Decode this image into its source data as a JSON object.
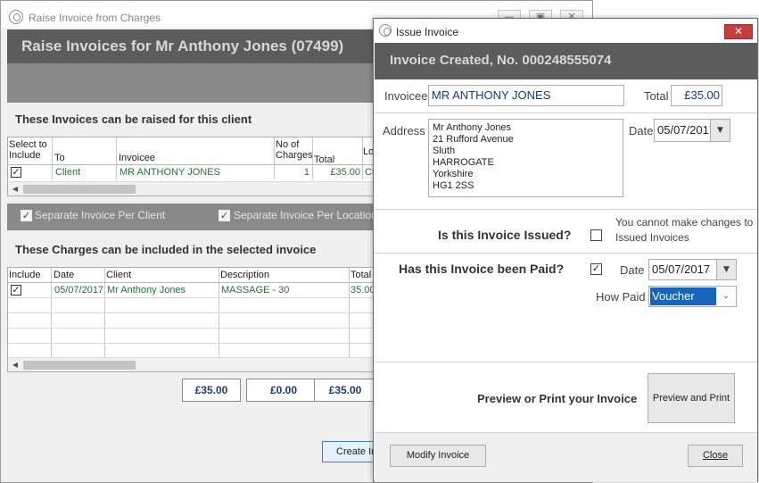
{
  "back_window": {
    "title": "Raise Invoice from Charges",
    "header": "Raise Invoices for Mr Anthony Jones (07499)",
    "invoices_section_label": "These Invoices can be raised for this client",
    "invoice_columns": [
      "Select to Include",
      "To",
      "Invoicee",
      "No of Charges",
      "Total",
      "Lo"
    ],
    "invoice_rows": [
      {
        "selected": "✓",
        "to": "Client",
        "invoicee": "MR ANTHONY JONES",
        "charges": "1",
        "total": "£35.00",
        "lo": "Cl"
      }
    ],
    "option_separate_client": "Separate Invoice Per Client",
    "option_separate_location": "Separate Invoice Per Location",
    "charges_section_label": "These Charges can be included in the selected invoice",
    "charge_columns": [
      "Include",
      "Date",
      "Client",
      "Description",
      "Total"
    ],
    "charge_rows": [
      {
        "include": "✓",
        "date": "05/07/2017",
        "client": "Mr Anthony Jones",
        "description": "MASSAGE - 30",
        "total": "35.00"
      }
    ],
    "totals": [
      "£35.00",
      "£0.00",
      "£35.00"
    ],
    "create_button": "Create Invoice"
  },
  "dialog": {
    "title": "Issue Invoice",
    "close_glyph": "✕",
    "header": "Invoice Created, No. 000248555074",
    "invoicee_label": "Invoicee",
    "invoicee_value": "MR ANTHONY JONES",
    "total_label": "Total",
    "total_value": "£35.00",
    "address_label": "Address",
    "address_lines": [
      "Mr Anthony Jones",
      "21 Rufford Avenue",
      "Sluth",
      "HARROGATE",
      "Yorkshire",
      "HG1 2SS"
    ],
    "date_label": "Date",
    "date_value": "05/07/2017",
    "issued_question": "Is this Invoice Issued?",
    "issued_checked": false,
    "issued_note": "You cannot make changes to Issued Invoices",
    "paid_question": "Has this Invoice been Paid?",
    "paid_checked": true,
    "paid_date_label": "Date",
    "paid_date_value": "05/07/2017",
    "how_paid_label": "How Paid",
    "how_paid_value": "Voucher",
    "preview_label": "Preview or Print your Invoice",
    "preview_button": "Preview and Print",
    "modify_button": "Modify Invoice",
    "close_button": "Close"
  },
  "colors": {
    "header_band": "#5c5c5c",
    "sub_band": "#8a8a8a",
    "green_text": "#1a7a2a",
    "value_blue": "#1a3a7a",
    "selected_highlight": "#1565c0",
    "close_red": "#c83c3c"
  },
  "icons": {
    "app": "app-logo-icon",
    "dropdown": "chevron-down-icon",
    "check": "checkmark-icon"
  }
}
